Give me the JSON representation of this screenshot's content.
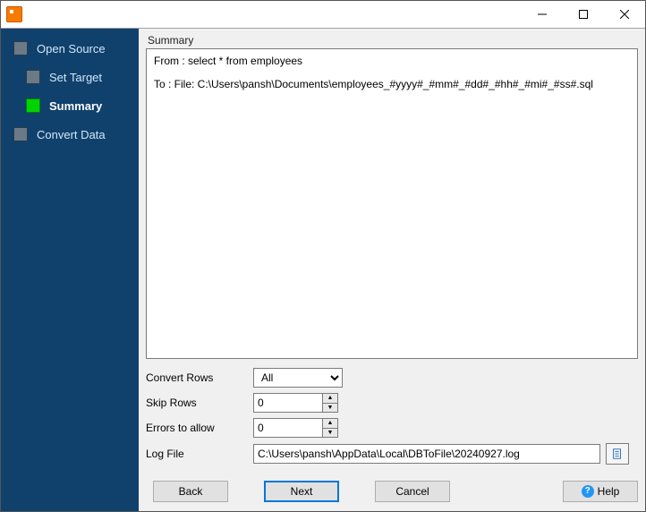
{
  "sidebar": {
    "steps": [
      {
        "label": "Open Source",
        "current": false,
        "sub": false
      },
      {
        "label": "Set Target",
        "current": false,
        "sub": true
      },
      {
        "label": "Summary",
        "current": true,
        "sub": true
      },
      {
        "label": "Convert Data",
        "current": false,
        "sub": false
      }
    ]
  },
  "main": {
    "section_title": "Summary",
    "summary_lines": {
      "from": "From : select * from employees",
      "to": "To : File: C:\\Users\\pansh\\Documents\\employees_#yyyy#_#mm#_#dd#_#hh#_#mi#_#ss#.sql"
    },
    "form": {
      "convert_rows": {
        "label": "Convert Rows",
        "value": "All"
      },
      "skip_rows": {
        "label": "Skip Rows",
        "value": "0"
      },
      "errors_allow": {
        "label": "Errors to allow",
        "value": "0"
      },
      "log_file": {
        "label": "Log File",
        "value": "C:\\Users\\pansh\\AppData\\Local\\DBToFile\\20240927.log"
      }
    }
  },
  "buttons": {
    "back": "Back",
    "next": "Next",
    "cancel": "Cancel",
    "help": "Help"
  }
}
